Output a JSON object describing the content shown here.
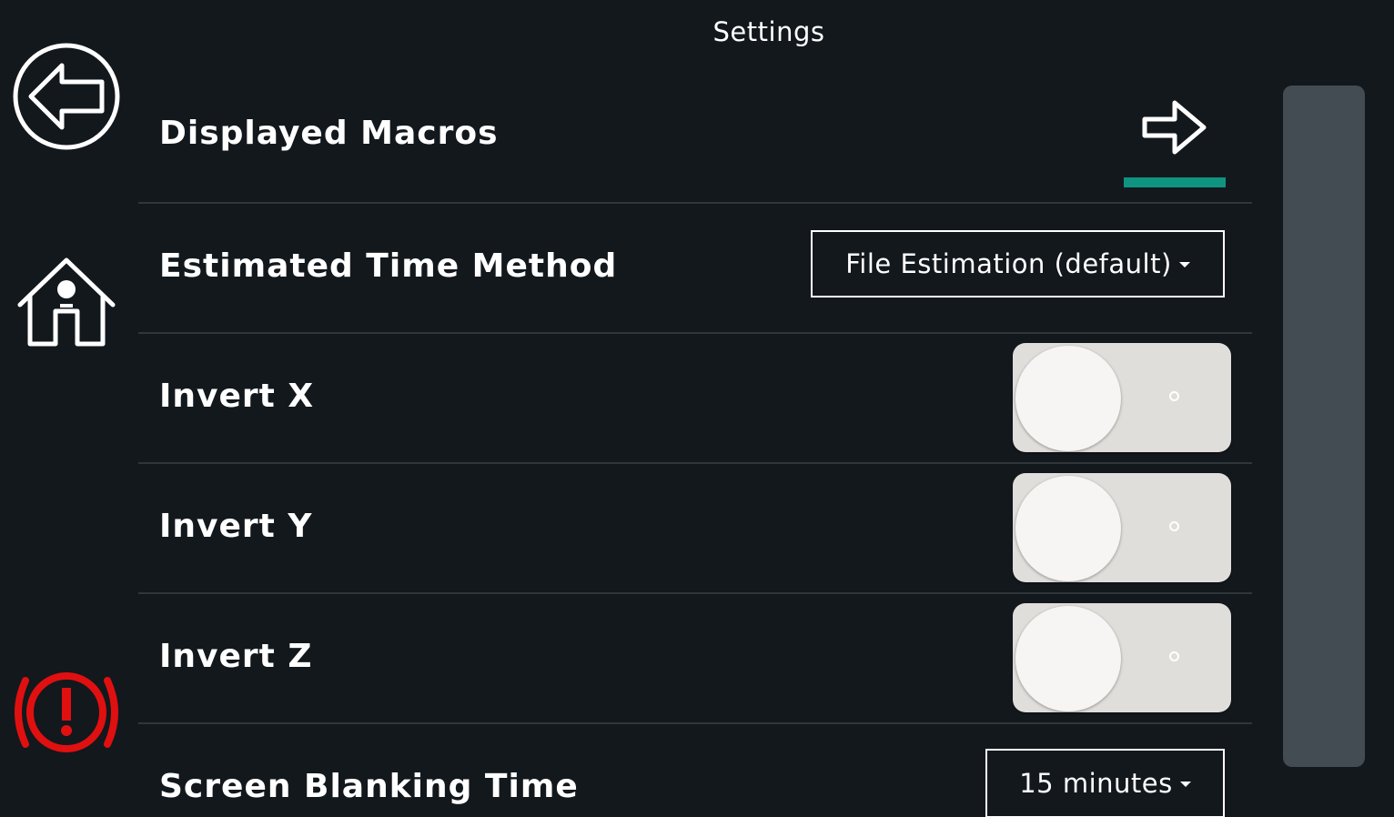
{
  "header": {
    "title": "Settings"
  },
  "sidebar": {
    "back_icon": "back-arrow-icon",
    "home_icon": "home-icon",
    "estop_icon": "emergency-stop-icon",
    "estop_color": "#e01010"
  },
  "settings": {
    "displayed_macros": {
      "label": "Displayed Macros",
      "icon": "arrow-right-icon",
      "accent_color": "#0f9482"
    },
    "estimated_time_method": {
      "label": "Estimated Time Method",
      "selected": "File Estimation (default)"
    },
    "invert_x": {
      "label": "Invert X",
      "enabled": false
    },
    "invert_y": {
      "label": "Invert Y",
      "enabled": false
    },
    "invert_z": {
      "label": "Invert Z",
      "enabled": false
    },
    "screen_blanking_time": {
      "label": "Screen Blanking Time",
      "selected": "15 minutes"
    }
  },
  "colors": {
    "background": "#13181d",
    "divider": "#2f363c",
    "scrollbar": "#434c53",
    "toggle_track": "#e0dedb"
  }
}
